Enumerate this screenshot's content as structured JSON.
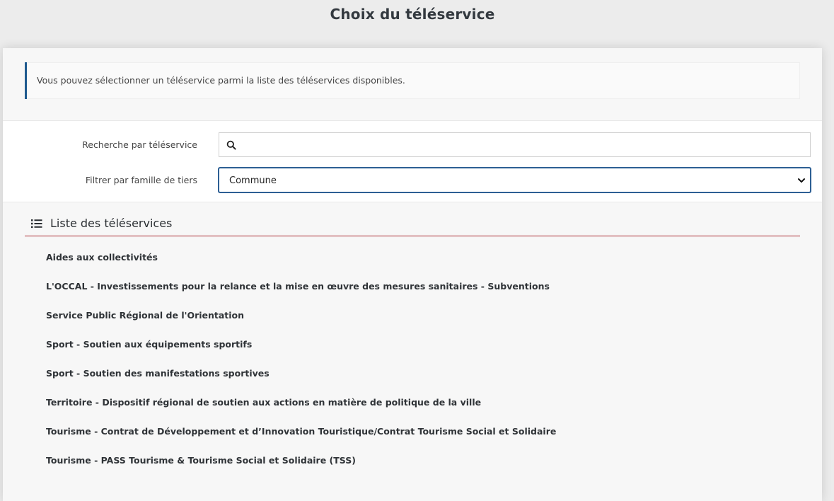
{
  "page": {
    "title": "Choix du téléservice"
  },
  "info": {
    "text": "Vous pouvez sélectionner un téléservice parmi la liste des téléservices disponibles."
  },
  "filters": {
    "search_label": "Recherche par téléservice",
    "search_value": "",
    "search_placeholder": "",
    "filter_label": "Filtrer par famille de tiers",
    "filter_selected": "Commune"
  },
  "section": {
    "title": "Liste des téléservices",
    "icon": "list-icon"
  },
  "services": [
    "Aides aux collectivités",
    "L'OCCAL - Investissements pour la relance et la mise en œuvre des mesures sanitaires - Subventions",
    "Service Public Régional de l'Orientation",
    "Sport - Soutien aux équipements sportifs",
    "Sport - Soutien des manifestations sportives",
    "Territoire - Dispositif régional de soutien aux actions en matière de politique de la ville",
    "Tourisme - Contrat de Développement et d’Innovation Touristique/Contrat Tourisme Social et Solidaire",
    "Tourisme - PASS Tourisme & Tourisme Social et Solidaire (TSS)"
  ],
  "colors": {
    "accent_blue": "#1f5a8f",
    "separator_red": "#a8262d",
    "background": "#ececec"
  }
}
